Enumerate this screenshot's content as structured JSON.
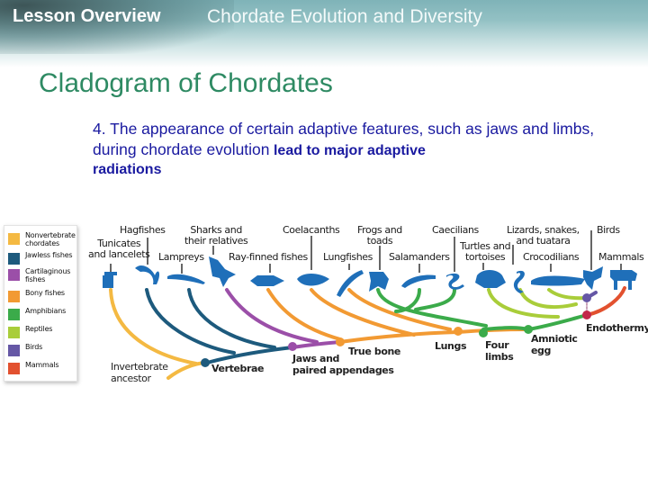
{
  "header": {
    "lesson_label": "Lesson Overview",
    "subtitle": "Chordate Evolution and Diversity"
  },
  "slide": {
    "title": "Cladogram of Chordates",
    "body_part1": "4. The appearance of certain adaptive features, such as jaws and limbs, during chordate evolution",
    "body_part2": " lead to major adaptive",
    "body_part3": "radiations"
  },
  "colors": {
    "nonvertebrate": "#f4b942",
    "jawless": "#1d5a7d",
    "cartilaginous": "#9b4fa8",
    "bony": "#f29a33",
    "amphibians": "#3bab4a",
    "reptiles": "#a9cd3a",
    "birds": "#6557a5",
    "mammals": "#e2512f",
    "animal_icon": "#1f6fb9",
    "endothermy_node": "#c2284a"
  },
  "legend": [
    {
      "label": "Nonvertebrate chordates",
      "color_key": "nonvertebrate"
    },
    {
      "label": "Jawless fishes",
      "color_key": "jawless"
    },
    {
      "label": "Cartilaginous fishes",
      "color_key": "cartilaginous"
    },
    {
      "label": "Bony fishes",
      "color_key": "bony"
    },
    {
      "label": "Amphibians",
      "color_key": "amphibians"
    },
    {
      "label": "Reptiles",
      "color_key": "reptiles"
    },
    {
      "label": "Birds",
      "color_key": "birds"
    },
    {
      "label": "Mammals",
      "color_key": "mammals"
    }
  ],
  "taxa": [
    {
      "name": "Tunicates and lancelets",
      "group": "nonvertebrate"
    },
    {
      "name": "Hagfishes",
      "group": "jawless"
    },
    {
      "name": "Lampreys",
      "group": "jawless"
    },
    {
      "name": "Sharks and their relatives",
      "group": "cartilaginous"
    },
    {
      "name": "Ray-finned fishes",
      "group": "bony"
    },
    {
      "name": "Coelacanths",
      "group": "bony"
    },
    {
      "name": "Lungfishes",
      "group": "bony"
    },
    {
      "name": "Frogs and toads",
      "group": "amphibians"
    },
    {
      "name": "Salamanders",
      "group": "amphibians"
    },
    {
      "name": "Caecilians",
      "group": "amphibians"
    },
    {
      "name": "Turtles and tortoises",
      "group": "reptiles"
    },
    {
      "name": "Lizards, snakes, and tuatara",
      "group": "reptiles"
    },
    {
      "name": "Crocodilians",
      "group": "reptiles"
    },
    {
      "name": "Birds",
      "group": "birds"
    },
    {
      "name": "Mammals",
      "group": "mammals"
    }
  ],
  "labels": {
    "tunicates_1": "Tunicates",
    "tunicates_2": "and lancelets",
    "hagfishes": "Hagfishes",
    "lampreys": "Lampreys",
    "sharks_1": "Sharks and",
    "sharks_2": "their relatives",
    "rayfinned": "Ray-finned fishes",
    "coelacanths": "Coelacanths",
    "lungfishes": "Lungfishes",
    "frogs_1": "Frogs and",
    "frogs_2": "toads",
    "salamanders": "Salamanders",
    "caecilians": "Caecilians",
    "turtles_1": "Turtles and",
    "turtles_2": "tortoises",
    "lizards_1": "Lizards, snakes,",
    "lizards_2": "and tuatara",
    "crocodilians": "Crocodilians",
    "birds": "Birds",
    "mammals": "Mammals"
  },
  "nodes": {
    "ancestor_1": "Invertebrate",
    "ancestor_2": "ancestor",
    "vertebrae": "Vertebrae",
    "jaws_1": "Jaws and",
    "jaws_2": "paired appendages",
    "true_bone": "True bone",
    "lungs": "Lungs",
    "four_limbs_1": "Four",
    "four_limbs_2": "limbs",
    "amniotic_1": "Amniotic",
    "amniotic_2": "egg",
    "endothermy": "Endothermy"
  }
}
